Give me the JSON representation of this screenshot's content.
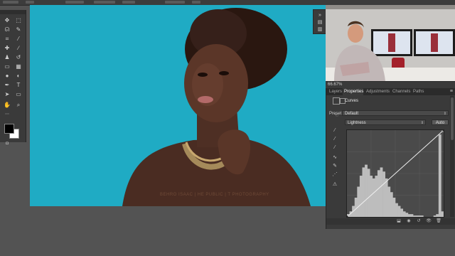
{
  "app": {
    "watermark": "BEHRO ISAAC | HE PUBLIC | T PHOTOGRAPHY"
  },
  "canvas": {
    "background_color": "#1fabc4"
  },
  "video": {
    "zoom": "66.67%"
  },
  "tools": [
    "move-tool-icon",
    "marquee-tool-icon",
    "lasso-tool-icon",
    "quick-select-tool-icon",
    "crop-tool-icon",
    "eyedropper-tool-icon",
    "healing-brush-icon",
    "brush-tool-icon",
    "clone-stamp-icon",
    "history-brush-icon",
    "eraser-tool-icon",
    "gradient-tool-icon",
    "blur-tool-icon",
    "dodge-tool-icon",
    "pen-tool-icon",
    "type-tool-icon",
    "path-select-icon",
    "shape-tool-icon",
    "hand-tool-icon",
    "zoom-tool-icon"
  ],
  "panel": {
    "tabs": [
      {
        "label": "Layers"
      },
      {
        "label": "Properties"
      },
      {
        "label": "Adjustments"
      },
      {
        "label": "Channels"
      },
      {
        "label": "Paths"
      }
    ],
    "active_tab": "Properties",
    "title": "Curves",
    "preset_label": "Preset:",
    "preset_value": "Default",
    "channel_value": "Lightness",
    "auto_label": "Auto"
  },
  "curve": {
    "points": [
      [
        0,
        0
      ],
      [
        255,
        255
      ]
    ],
    "histogram": [
      2,
      4,
      8,
      14,
      22,
      30,
      36,
      38,
      35,
      30,
      28,
      30,
      34,
      36,
      33,
      28,
      22,
      18,
      14,
      10,
      8,
      6,
      4,
      3,
      2,
      2,
      1,
      1,
      1,
      1,
      0,
      0,
      0,
      0,
      1,
      2,
      60,
      4
    ]
  }
}
